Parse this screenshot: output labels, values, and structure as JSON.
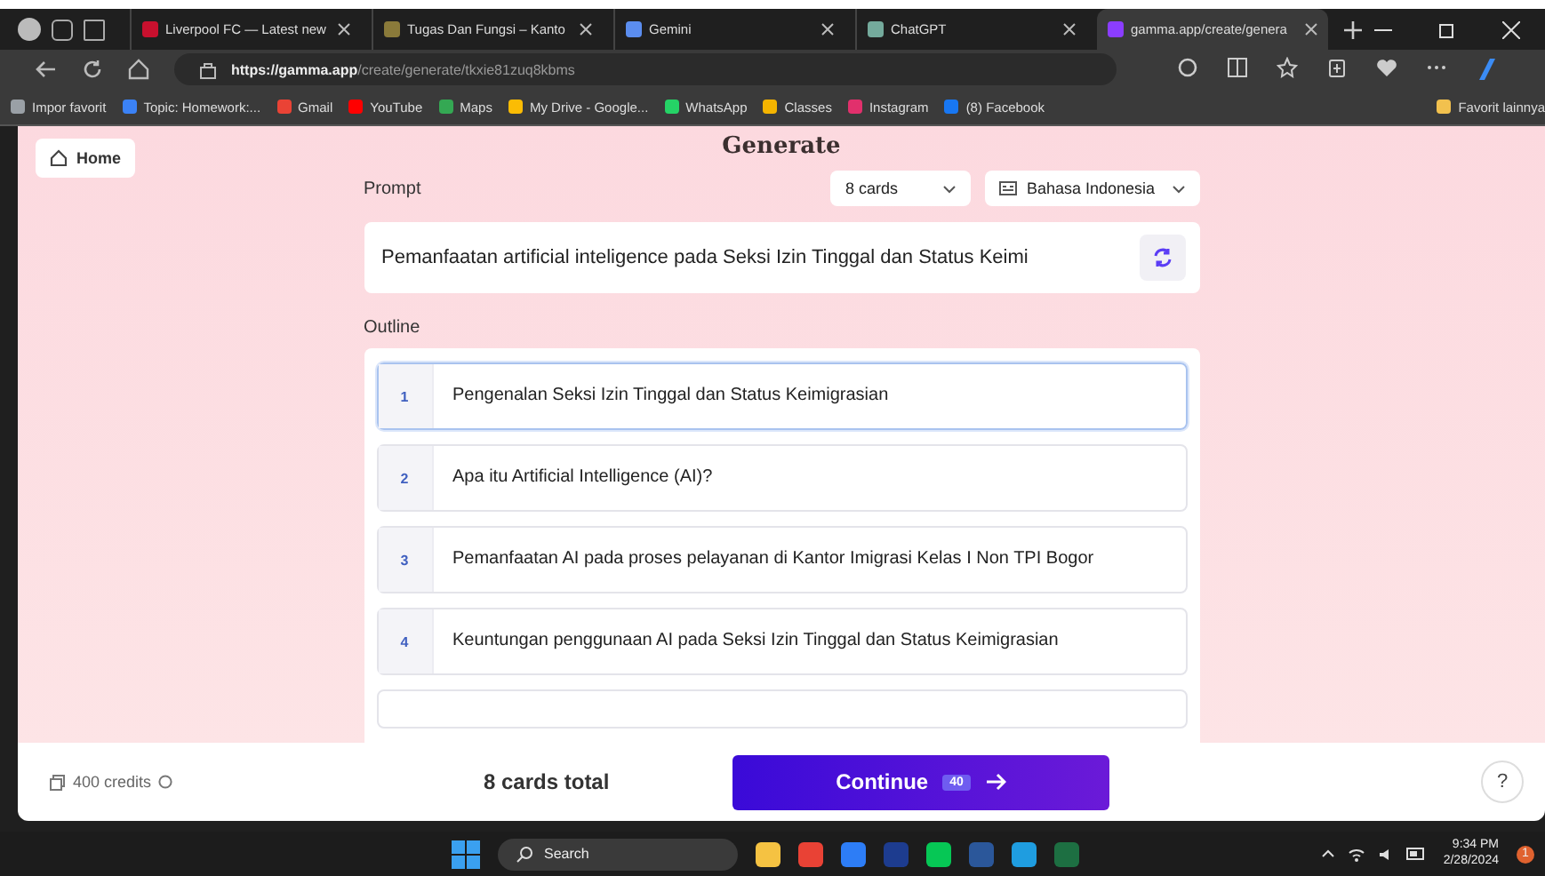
{
  "browser": {
    "tabs": [
      {
        "title": "Liverpool FC — Latest new",
        "color": "#c8102e",
        "selected": false
      },
      {
        "title": "Tugas Dan Fungsi – Kanto",
        "color": "#8a7a3a",
        "selected": false
      },
      {
        "title": "Gemini",
        "color": "#5b8def",
        "selected": false
      },
      {
        "title": "ChatGPT",
        "color": "#74aa9c",
        "selected": false
      },
      {
        "title": "gamma.app/create/genera",
        "color": "#8b3dff",
        "selected": true
      }
    ],
    "address_host": "https://gamma.app",
    "address_path": "/create/generate/tkxie81zuq8kbms",
    "bookmarks": [
      {
        "label": "Impor favorit",
        "color": "#9aa0a6"
      },
      {
        "label": "Topic: Homework:...",
        "color": "#3b82f6"
      },
      {
        "label": "Gmail",
        "color": "#ea4335"
      },
      {
        "label": "YouTube",
        "color": "#ff0000"
      },
      {
        "label": "Maps",
        "color": "#34a853"
      },
      {
        "label": "My Drive - Google...",
        "color": "#fbbc04"
      },
      {
        "label": "WhatsApp",
        "color": "#25d366"
      },
      {
        "label": "Classes",
        "color": "#f4b400"
      },
      {
        "label": "Instagram",
        "color": "#e1306c"
      },
      {
        "label": "(8) Facebook",
        "color": "#1877f2"
      }
    ],
    "other_bookmarks": "Favorit lainnya"
  },
  "page": {
    "home": "Home",
    "title": "Generate",
    "prompt_label": "Prompt",
    "cards_select": "8 cards",
    "language_select": "Bahasa Indonesia",
    "prompt": "Pemanfaatan artificial inteligence pada Seksi Izin Tinggal dan Status Keimi",
    "outline_label": "Outline",
    "outline": [
      {
        "number": "1",
        "text": "Pengenalan Seksi Izin Tinggal dan Status Keimigrasian",
        "selected": true
      },
      {
        "number": "2",
        "text": "Apa itu Artificial Intelligence (AI)?",
        "selected": false
      },
      {
        "number": "3",
        "text": "Pemanfaatan AI pada proses pelayanan di Kantor Imigrasi Kelas I Non TPI Bogor",
        "selected": false
      },
      {
        "number": "4",
        "text": "Keuntungan penggunaan AI pada Seksi Izin Tinggal dan Status Keimigrasian",
        "selected": false
      }
    ],
    "credits": "400 credits",
    "total": "8 cards total",
    "continue": "Continue",
    "continue_badge": "40",
    "help": "?"
  },
  "taskbar": {
    "search": "Search",
    "time": "9:34 PM",
    "date": "2/28/2024",
    "notifications": "1"
  }
}
